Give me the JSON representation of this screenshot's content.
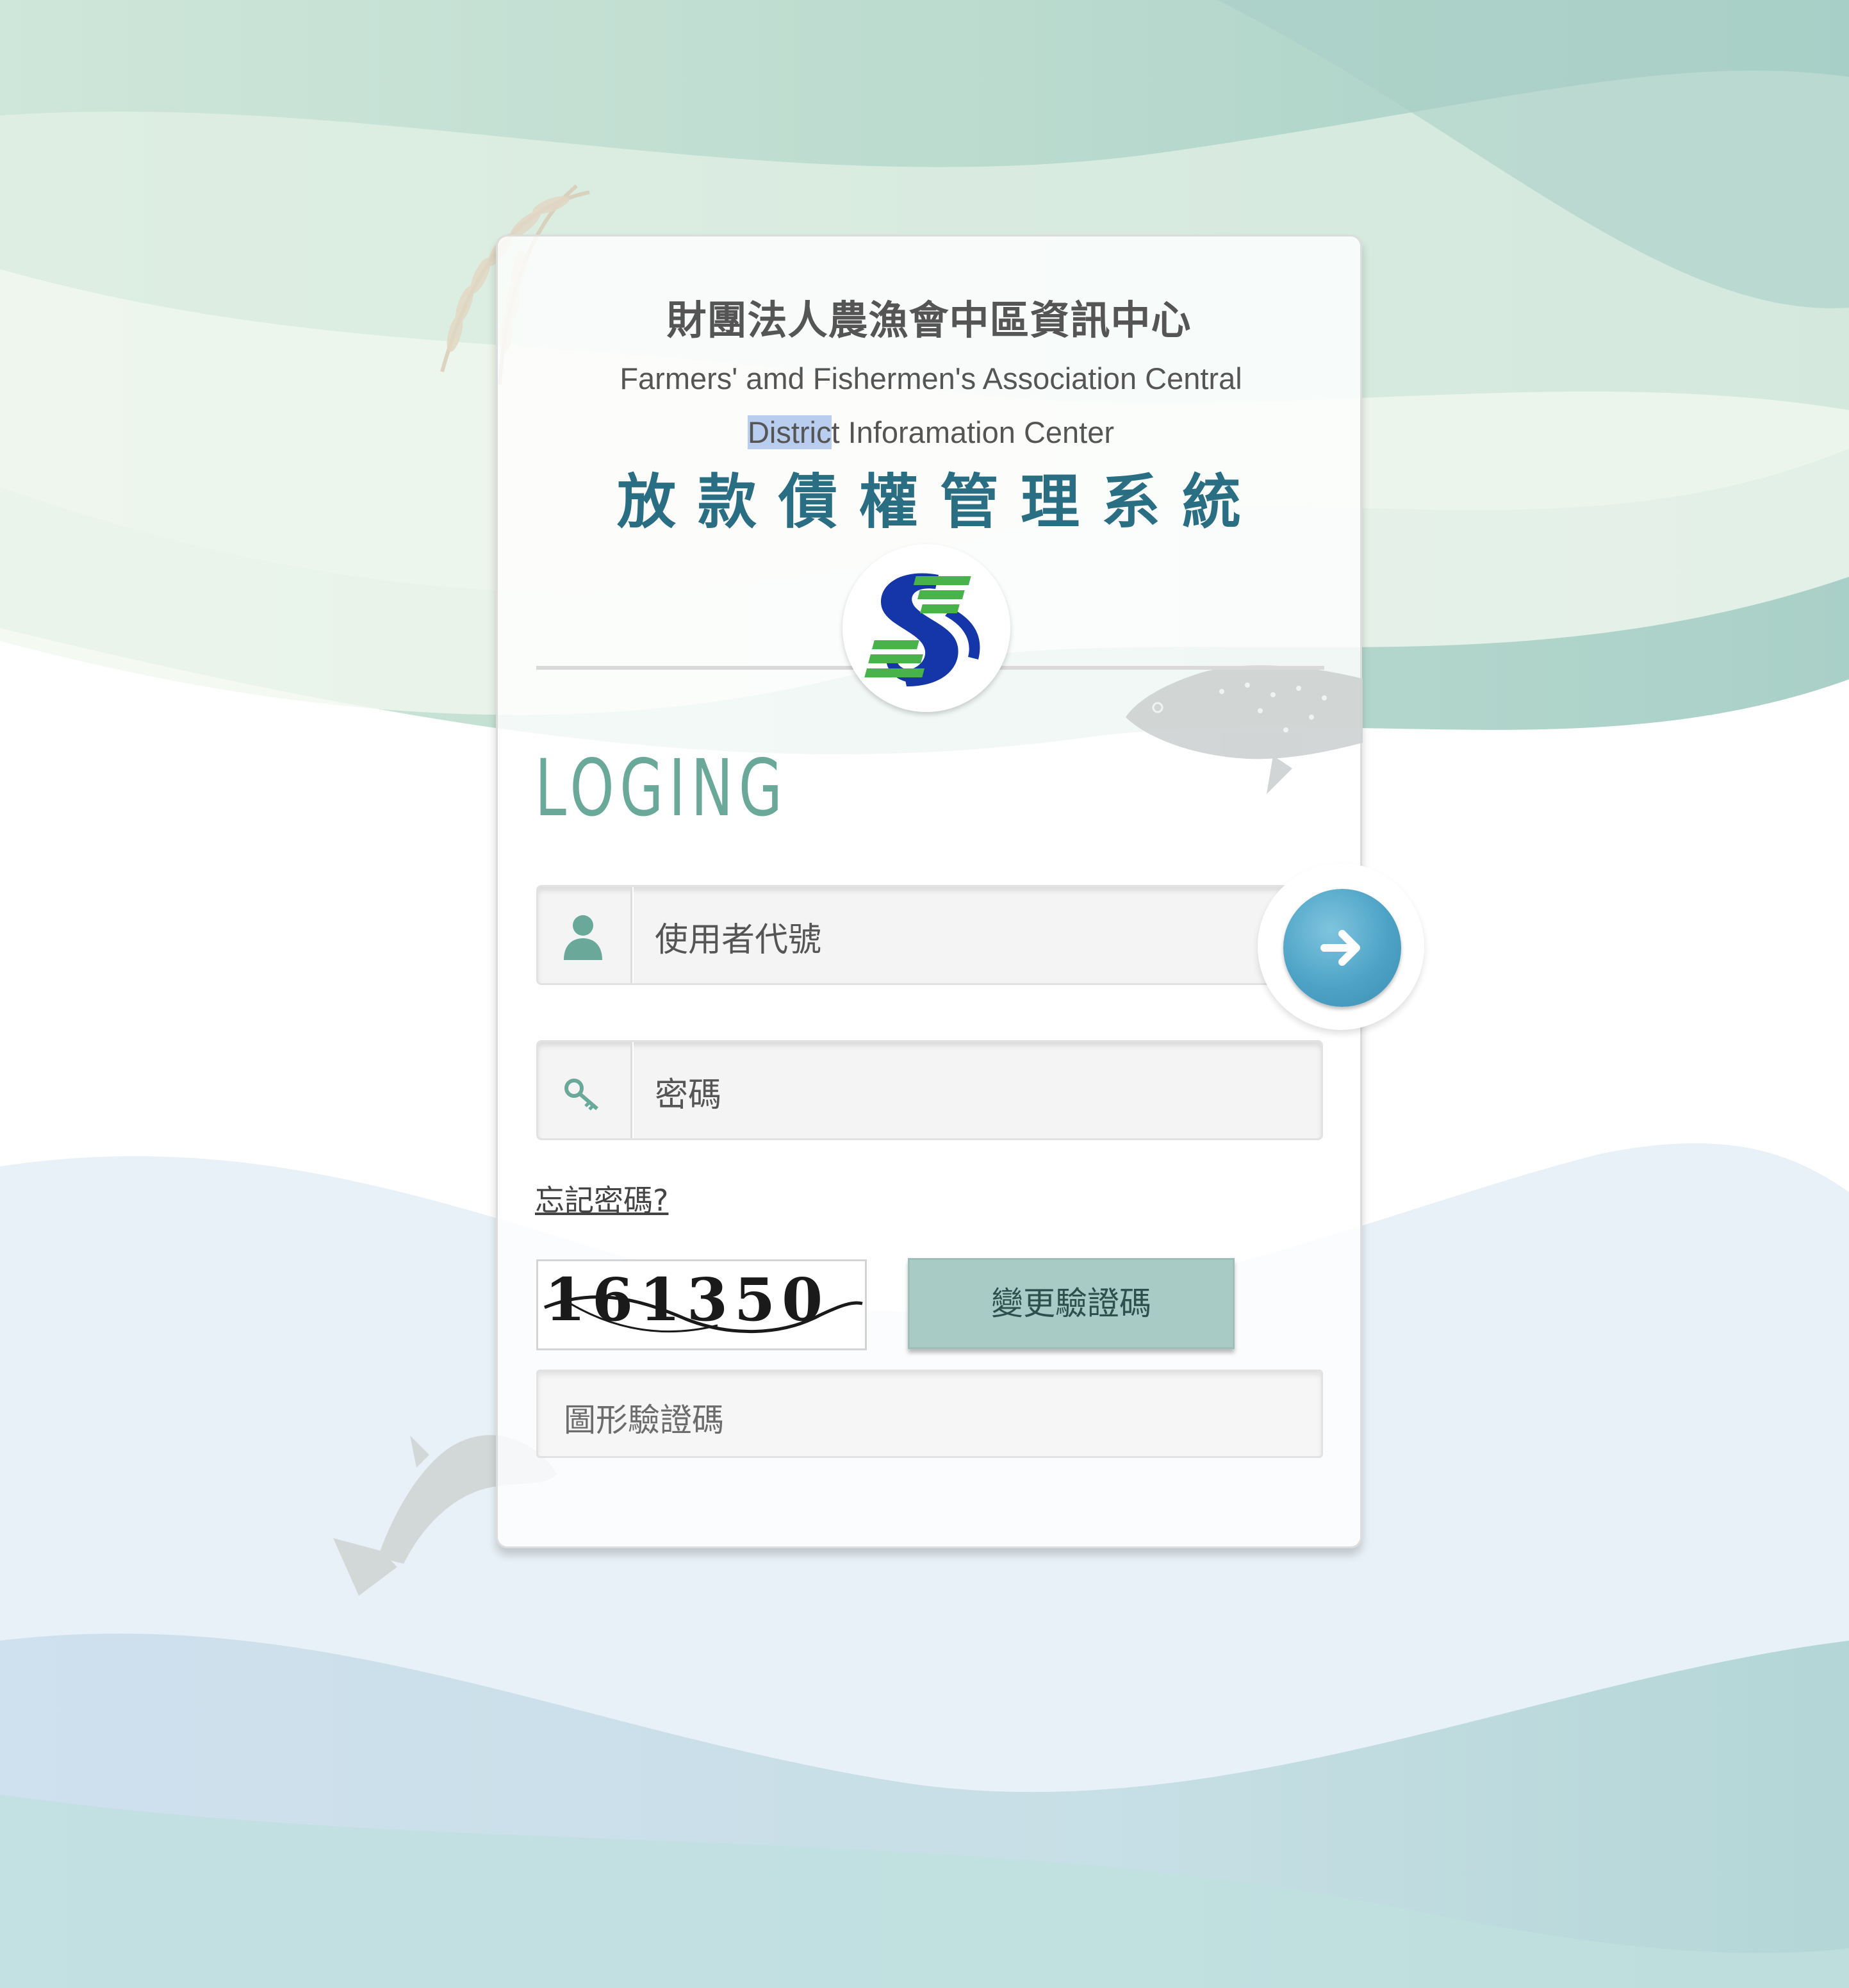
{
  "header": {
    "org_name_cn": "財團法人農漁會中區資訊中心",
    "org_name_en_line1": "Farmers' amd Fishermen's Association Central",
    "org_name_en_line2_selected": "Distric",
    "org_name_en_line2_rest": "t Inforamation Center",
    "system_title": "放款債權管理系統"
  },
  "login": {
    "heading": "LOGING",
    "username_placeholder": "使用者代號",
    "password_placeholder": "密碼",
    "forgot_password": "忘記密碼?",
    "captcha_code": "161350",
    "change_captcha_label": "變更驗證碼",
    "captcha_placeholder": "圖形驗證碼"
  },
  "icons": {
    "user": "user-icon",
    "key": "key-icon",
    "submit": "arrow-right-icon",
    "logo": "association-logo"
  },
  "colors": {
    "title_teal": "#2a6e84",
    "heading_green": "#6aa99a",
    "submit_blue": "#4da3c6",
    "change_button": "#a8ccc5"
  }
}
